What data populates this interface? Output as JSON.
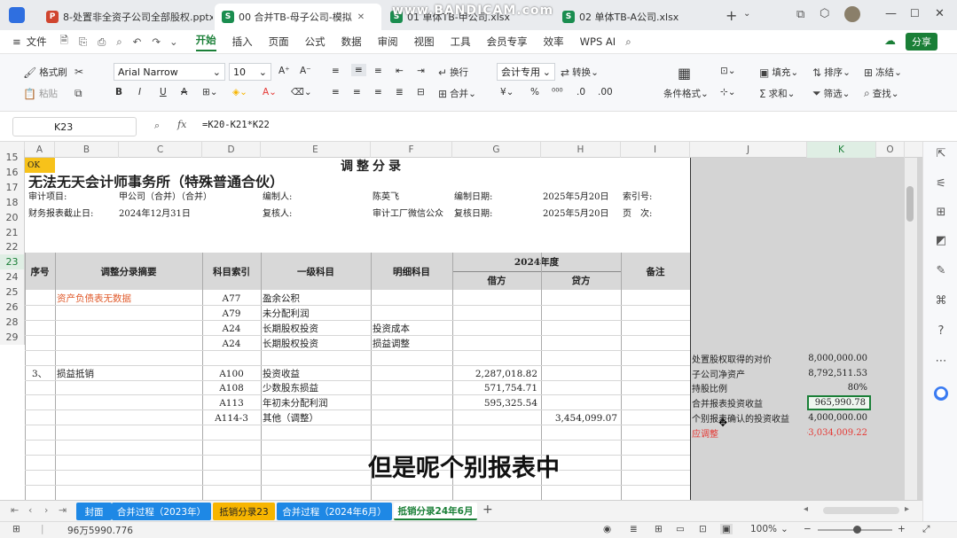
{
  "tabs": [
    {
      "icon": "P",
      "color": "#d0452f",
      "label": "8-处置非全资子公司全部股权.pptx"
    },
    {
      "icon": "S",
      "color": "#1a8d4f",
      "label": "00 合并TB-母子公司-模拟"
    },
    {
      "icon": "S",
      "color": "#1a8d4f",
      "label": "01 单体TB-甲公司.xlsx"
    },
    {
      "icon": "S",
      "color": "#1a8d4f",
      "label": "02 单体TB-A公司.xlsx"
    }
  ],
  "watermark": "www.BANDICAM.com",
  "menu": {
    "file": "文件",
    "items": [
      "开始",
      "插入",
      "页面",
      "公式",
      "数据",
      "审阅",
      "视图",
      "工具",
      "会员专享",
      "效率",
      "WPS AI"
    ],
    "share": "分享"
  },
  "ribbon": {
    "format_painter": "格式刷",
    "paste": "粘贴",
    "font_name": "Arial Narrow",
    "font_size": "10",
    "wrap": "换行",
    "number_format": "会计专用",
    "convert": "转换",
    "merge": "合并",
    "cond_format": "条件格式",
    "fill": "填充",
    "sort": "排序",
    "freeze": "冻结",
    "sum": "求和",
    "filter": "筛选",
    "find": "查找"
  },
  "formula": {
    "cell_ref": "K23",
    "fx": "fx",
    "formula": "=K20-K21*K22"
  },
  "columns": [
    "A",
    "B",
    "C",
    "D",
    "E",
    "F",
    "G",
    "H",
    "I",
    "J",
    "K",
    "O"
  ],
  "sheet": {
    "ok": "OK",
    "title": "调整分录",
    "firm": "无法无天会计师事务所（特殊普通合伙）",
    "row3": {
      "l1": "审计项目:",
      "v1": "甲公司（合并）（合并）",
      "l2": "编制人:",
      "v2": "陈英飞",
      "l3": "编制日期:",
      "v3": "2025年5月20日",
      "l4": "索引号:"
    },
    "row5": {
      "l1": "财务报表截止日:",
      "v1": "2024年12月31日",
      "l2": "复核人:",
      "v2": "审计工厂微信公众",
      "l3": "复核日期:",
      "v3": "2025年5月20日",
      "l4": "页　次:"
    },
    "headers": {
      "seq": "序号",
      "summary": "调整分录摘要",
      "index": "科目索引",
      "level1": "一级科目",
      "detail": "明细科目",
      "year": "2024年度",
      "debit": "借方",
      "credit": "贷方",
      "remark": "备注"
    },
    "rows": [
      {
        "num": "15",
        "seq": "",
        "summary": "资产负债表无数据",
        "index": "A77",
        "level1": "盈余公积",
        "detail": "",
        "debit": "",
        "credit": ""
      },
      {
        "num": "16",
        "seq": "",
        "summary": "",
        "index": "A79",
        "level1": "未分配利润",
        "detail": "",
        "debit": "",
        "credit": ""
      },
      {
        "num": "17",
        "seq": "",
        "summary": "",
        "index": "A24",
        "level1": "长期股权投资",
        "detail": "投资成本",
        "debit": "",
        "credit": ""
      },
      {
        "num": "18",
        "seq": "",
        "summary": "",
        "index": "A24",
        "level1": "长期股权投资",
        "detail": "损益调整",
        "debit": "",
        "credit": ""
      },
      {
        "num": "20",
        "seq": "",
        "summary": "",
        "index": "",
        "level1": "",
        "detail": "",
        "debit": "",
        "credit": ""
      },
      {
        "num": "21",
        "seq": "3、",
        "summary": "损益抵销",
        "index": "A100",
        "level1": "投资收益",
        "detail": "",
        "debit": "2,287,018.82",
        "credit": ""
      },
      {
        "num": "22",
        "seq": "",
        "summary": "",
        "index": "A108",
        "level1": "少数股东损益",
        "detail": "",
        "debit": "571,754.71",
        "credit": ""
      },
      {
        "num": "23",
        "seq": "",
        "summary": "",
        "index": "A113",
        "level1": "年初未分配利润",
        "detail": "",
        "debit": "595,325.54",
        "credit": ""
      },
      {
        "num": "24",
        "seq": "",
        "summary": "",
        "index": "A114-3",
        "level1": "其他（调整）",
        "detail": "",
        "debit": "",
        "credit": "3,454,099.07"
      },
      {
        "num": "25",
        "seq": "",
        "summary": "",
        "index": "",
        "level1": "",
        "detail": "",
        "debit": "",
        "credit": ""
      },
      {
        "num": "26",
        "seq": "",
        "summary": "",
        "index": "",
        "level1": "",
        "detail": "",
        "debit": "",
        "credit": ""
      },
      {
        "num": "28",
        "seq": "",
        "summary": "",
        "index": "",
        "level1": "",
        "detail": "",
        "debit": "",
        "credit": ""
      },
      {
        "num": "29",
        "seq": "",
        "summary": "",
        "index": "",
        "level1": "",
        "detail": "",
        "debit": "",
        "credit": ""
      }
    ],
    "side": [
      {
        "label": "处置股权取得的对价",
        "value": "8,000,000.00",
        "color": "#222"
      },
      {
        "label": "子公司净资产",
        "value": "8,792,511.53",
        "color": "#222"
      },
      {
        "label": "持股比例",
        "value": "80%",
        "color": "#222"
      },
      {
        "label": "合并报表投资收益",
        "value": "965,990.78",
        "color": "#222"
      },
      {
        "label": "个别报表确认的投资收益",
        "value": "4,000,000.00",
        "color": "#222"
      },
      {
        "label": "应调整",
        "value": "-3,034,009.22",
        "color": "#e53935"
      }
    ]
  },
  "sheet_tabs": [
    {
      "label": "封面",
      "bg": "#1e88e5",
      "color": "#ffffff"
    },
    {
      "label": "合并过程（2023年）",
      "bg": "#1e88e5",
      "color": "#ffffff"
    },
    {
      "label": "抵销分录23",
      "bg": "#f7b500",
      "color": "#222222"
    },
    {
      "label": "合并过程（2024年6月）",
      "bg": "#1e88e5",
      "color": "#ffffff"
    },
    {
      "label": "抵销分录24年6月",
      "bg": "#ffffff",
      "color": "#1a7f37"
    }
  ],
  "status": {
    "value": "96万5990.776",
    "zoom": "100%"
  },
  "subtitle": "但是呢个别报表中",
  "accent": "#1a7f37"
}
